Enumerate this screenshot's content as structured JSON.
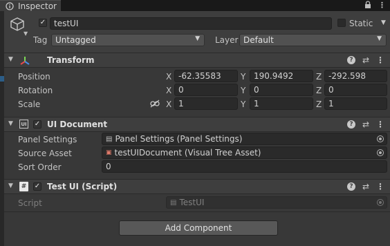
{
  "tab": {
    "title": "Inspector"
  },
  "gameobject": {
    "active": true,
    "name": "testUI",
    "static_label": "Static",
    "tag_label": "Tag",
    "tag_value": "Untagged",
    "layer_label": "Layer",
    "layer_value": "Default"
  },
  "transform": {
    "title": "Transform",
    "rows": [
      {
        "label": "Position",
        "x": "-62.35583",
        "y": "190.9492",
        "z": "-292.598"
      },
      {
        "label": "Rotation",
        "x": "0",
        "y": "0",
        "z": "0"
      },
      {
        "label": "Scale",
        "x": "1",
        "y": "1",
        "z": "1"
      }
    ],
    "axes": {
      "x": "X",
      "y": "Y",
      "z": "Z"
    }
  },
  "ui_document": {
    "title": "UI Document",
    "enabled": true,
    "panel_settings_label": "Panel Settings",
    "panel_settings_value": "Panel Settings (Panel Settings)",
    "source_asset_label": "Source Asset",
    "source_asset_value": "testUIDocument (Visual Tree Asset)",
    "sort_order_label": "Sort Order",
    "sort_order_value": "0"
  },
  "script_component": {
    "title": "Test UI (Script)",
    "enabled": true,
    "script_label": "Script",
    "script_value": "TestUI"
  },
  "add_component": {
    "label": "Add Component"
  }
}
